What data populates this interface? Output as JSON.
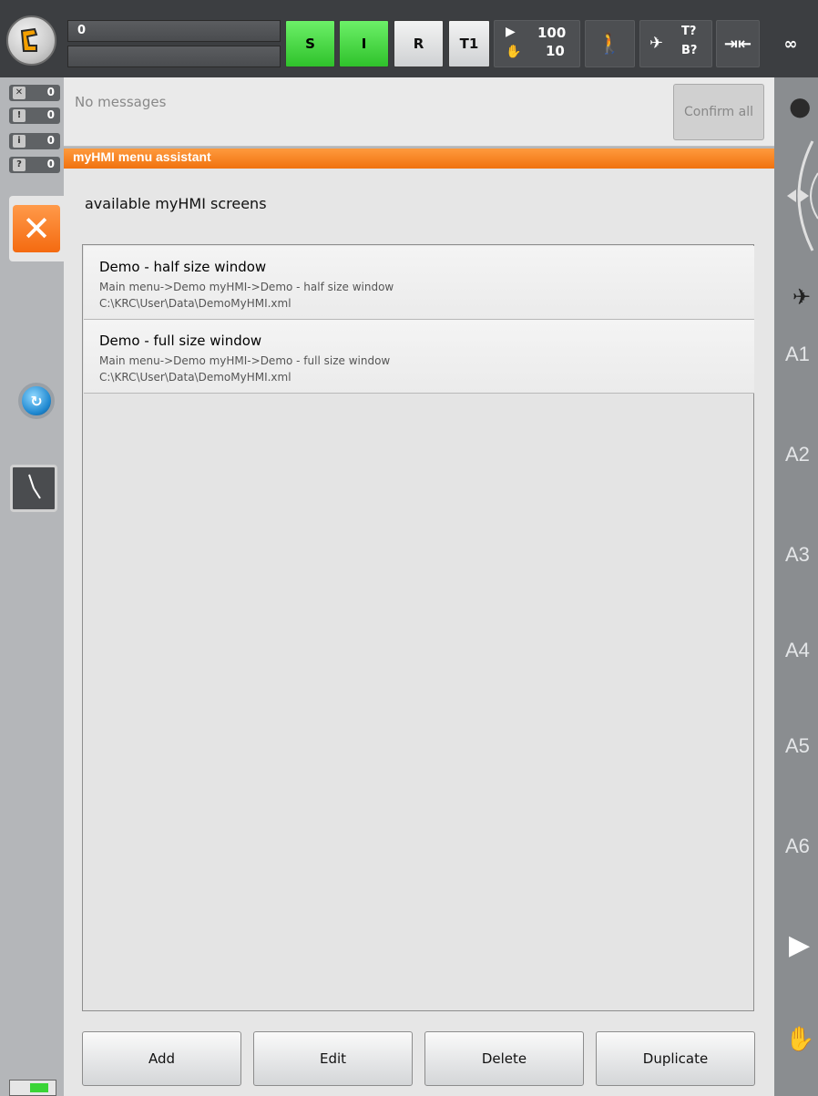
{
  "status_bar": {
    "field_top_value": "0",
    "buttons": {
      "s": "S",
      "i": "I",
      "r": "R",
      "mode": "T1"
    },
    "override": {
      "program": "100",
      "jog": "10"
    },
    "tool_base": {
      "tool": "T?",
      "base": "B?"
    },
    "infinity": "∞"
  },
  "message_counters": [
    {
      "type": "acknowledgement",
      "count": "0"
    },
    {
      "type": "state",
      "count": "0"
    },
    {
      "type": "info",
      "count": "0"
    },
    {
      "type": "dialog",
      "count": "0"
    }
  ],
  "messages": {
    "text": "No messages",
    "confirm_label": "Confirm all"
  },
  "window": {
    "title": "myHMI menu assistant",
    "heading": "available myHMI screens",
    "items": [
      {
        "title": "Demo - half size window",
        "path": "Main menu->Demo myHMI->Demo - half size window",
        "file": "C:\\KRC\\User\\Data\\DemoMyHMI.xml"
      },
      {
        "title": "Demo - full size window",
        "path": "Main menu->Demo myHMI->Demo - full size window",
        "file": "C:\\KRC\\User\\Data\\DemoMyHMI.xml"
      }
    ],
    "buttons": {
      "add": "Add",
      "edit": "Edit",
      "delete": "Delete",
      "duplicate": "Duplicate"
    }
  },
  "axes": [
    "A1",
    "A2",
    "A3",
    "A4",
    "A5",
    "A6"
  ],
  "colors": {
    "accent": "#f07a1a",
    "status_green": "#3ad436",
    "close": "#ff7f24"
  }
}
